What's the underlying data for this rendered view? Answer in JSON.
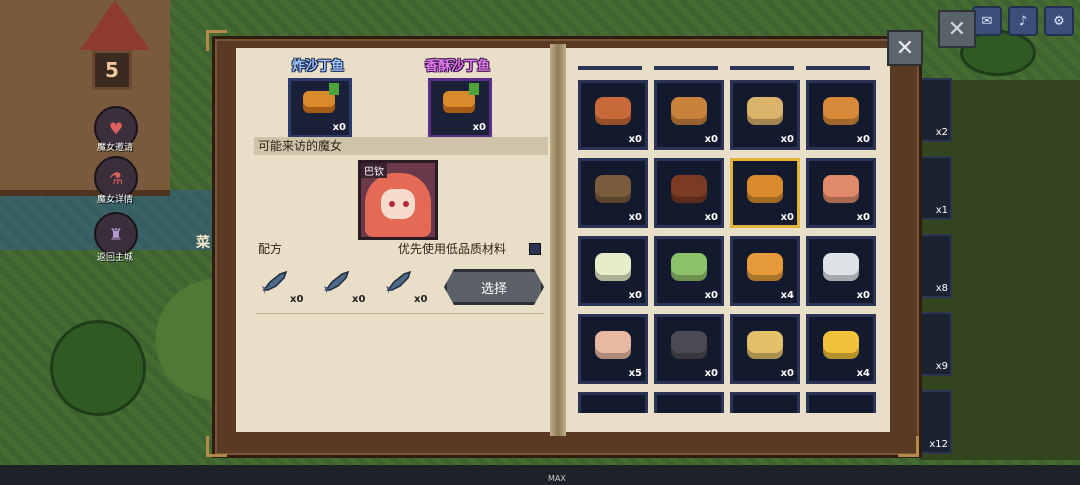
{
  "hud": {
    "level": "5",
    "side_buttons": [
      {
        "label": "魔女邀请",
        "icon": "heart-icon"
      },
      {
        "label": "魔女详情",
        "icon": "potion-icon"
      },
      {
        "label": "返回主城",
        "icon": "castle-icon"
      }
    ],
    "top_icons": [
      "mail-icon",
      "sound-icon",
      "gear-icon"
    ],
    "bottom_label": "MAX",
    "behind_label": "菜",
    "right_counts": [
      "x2",
      "x1",
      "x8",
      "x9",
      "x12"
    ]
  },
  "recipe_book": {
    "dishes": [
      {
        "name": "炸沙丁鱼",
        "count": "x0",
        "style": "blue"
      },
      {
        "name": "香酥沙丁鱼",
        "count": "x0",
        "style": "purple"
      }
    ],
    "visitor_section": "可能来访的魔女",
    "visitor": {
      "name": "巴钦"
    },
    "recipe_section": "配方",
    "low_quality_toggle": "优先使用低品质材料",
    "ingredients": [
      {
        "icon": "sardine-icon",
        "count": "x0"
      },
      {
        "icon": "sardine-icon",
        "count": "x0"
      },
      {
        "icon": "sardine-icon",
        "count": "x0"
      }
    ],
    "select_button": "选择",
    "grid": [
      {
        "icon": "sushi-platter-icon",
        "count": "x0",
        "color": "#c8693a"
      },
      {
        "icon": "sandwich-icon",
        "count": "x0",
        "color": "#c9823c"
      },
      {
        "icon": "pie-icon",
        "count": "x0",
        "color": "#d9b36a"
      },
      {
        "icon": "gratin-icon",
        "count": "x0",
        "color": "#d88a3a"
      },
      {
        "icon": "basket-icon",
        "count": "x0",
        "color": "#7a5c3c"
      },
      {
        "icon": "steak-icon",
        "count": "x0",
        "color": "#7a3a24"
      },
      {
        "icon": "fried-fish-icon",
        "count": "x0",
        "color": "#d98a2c",
        "selected": true
      },
      {
        "icon": "tuna-sushi-icon",
        "count": "x0",
        "color": "#e08a6a"
      },
      {
        "icon": "soup-bowl-icon",
        "count": "x0",
        "color": "#e6eec9"
      },
      {
        "icon": "salad-icon",
        "count": "x0",
        "color": "#8ec26a"
      },
      {
        "icon": "pizza-icon",
        "count": "x4",
        "color": "#e69a3a"
      },
      {
        "icon": "rice-ball-icon",
        "count": "x0",
        "color": "#dfe3e6"
      },
      {
        "icon": "shrimp-plate-icon",
        "count": "x5",
        "color": "#e8b9a0"
      },
      {
        "icon": "mussel-icon",
        "count": "x0",
        "color": "#4a4a52"
      },
      {
        "icon": "bun-icon",
        "count": "x0",
        "color": "#e2c06a"
      },
      {
        "icon": "corn-icon",
        "count": "x4",
        "color": "#f0c23a"
      }
    ]
  }
}
